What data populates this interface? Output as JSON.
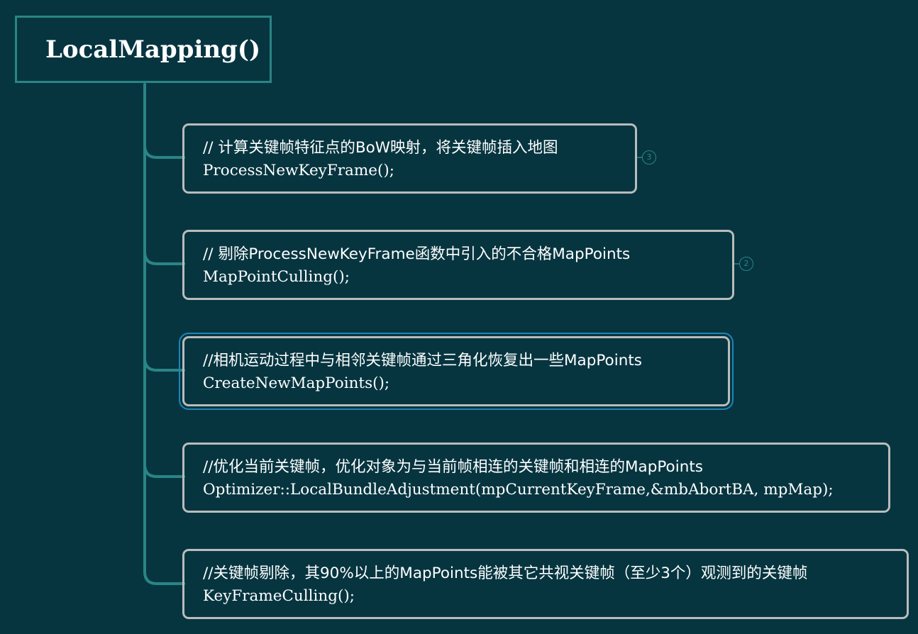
{
  "root": {
    "title": "LocalMapping()"
  },
  "colors": {
    "background": "#063540",
    "connector": "#2a8584",
    "node_border": "#b9bcbc",
    "selected_outline": "#1c86b8",
    "text": "#ffffff"
  },
  "nodes": [
    {
      "comment": "// 计算关键帧特征点的BoW映射，将关键帧插入地图",
      "code": "ProcessNewKeyFrame();",
      "badge": "3"
    },
    {
      "comment": "// 剔除ProcessNewKeyFrame函数中引入的不合格MapPoints",
      "code": "MapPointCulling();",
      "badge": "2"
    },
    {
      "comment": "//相机运动过程中与相邻关键帧通过三角化恢复出一些MapPoints",
      "code": "CreateNewMapPoints();",
      "selected": true
    },
    {
      "comment": "//优化当前关键帧，优化对象为与当前帧相连的关键帧和相连的MapPoints",
      "code": "Optimizer::LocalBundleAdjustment(mpCurrentKeyFrame,&mbAbortBA, mpMap);"
    },
    {
      "comment": "//关键帧剔除，其90%以上的MapPoints能被其它共视关键帧（至少3个）观测到的关键帧",
      "code": "KeyFrameCulling();"
    }
  ]
}
